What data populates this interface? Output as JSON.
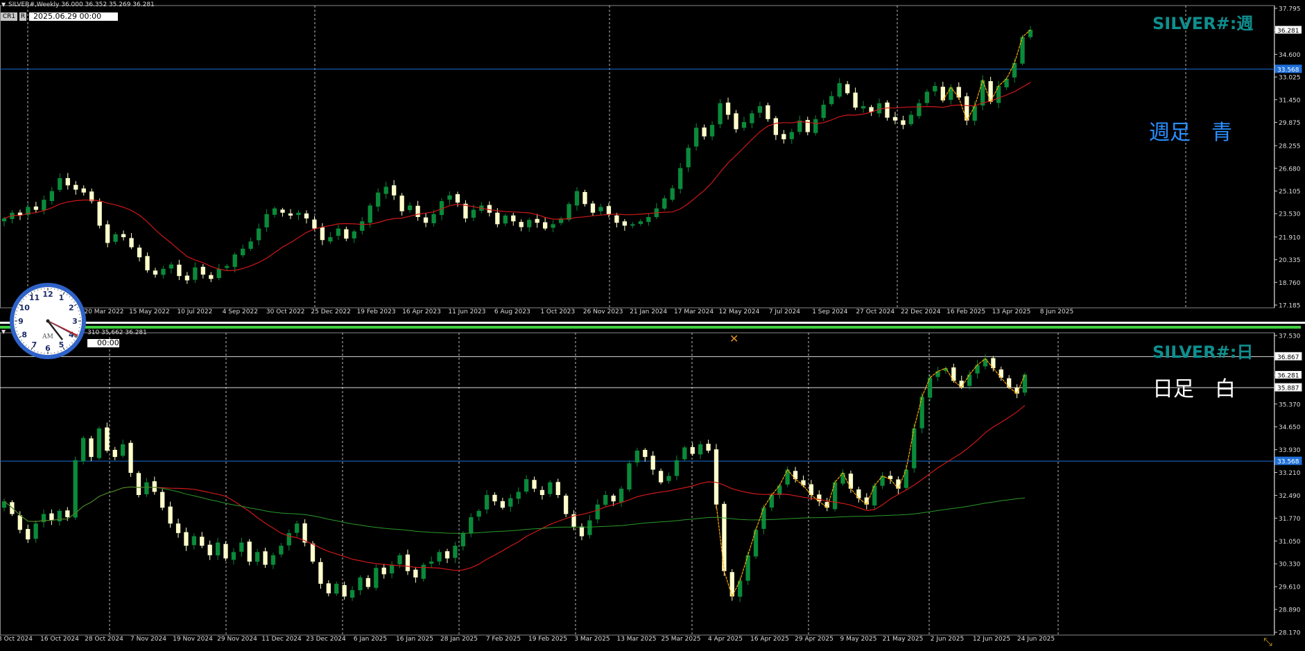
{
  "top": {
    "header": "SILVER#,Weekly  36.000 36.352 35.269 36.281",
    "btn_cr": "CR1",
    "btn_r": "R",
    "datetime": "2025.06.29 00:00",
    "symbol_label": "SILVER#:週",
    "note": "週足　青",
    "dates": [
      "20 Mar 2022",
      "15 May 2022",
      "10 Jul 2022",
      "4 Sep 2022",
      "30 Oct 2022",
      "25 Dec 2022",
      "19 Feb 2023",
      "16 Apr 2023",
      "11 Jun 2023",
      "6 Aug 2023",
      "1 Oct 2023",
      "26 Nov 2023",
      "21 Jan 2024",
      "17 Mar 2024",
      "12 May 2024",
      "7 Jul 2024",
      "1 Sep 2024",
      "27 Oct 2024",
      "22 Dec 2024",
      "16 Feb 2025",
      "13 Apr 2025",
      "8 Jun 2025"
    ],
    "prices": [
      "37.795",
      "36.281",
      "34.600",
      "33.568",
      "33.025",
      "31.450",
      "29.875",
      "28.255",
      "26.680",
      "25.105",
      "23.530",
      "21.910",
      "20.335",
      "18.760",
      "17.185"
    ],
    "hline_label": "33.568",
    "current_label": "36.281"
  },
  "bottom": {
    "header": "310 35.662 36.281",
    "datetime": "00:00",
    "symbol_label": "SILVER#:日",
    "note": "日足　白",
    "dates": [
      "3 Oct 2024",
      "16 Oct 2024",
      "28 Oct 2024",
      "7 Nov 2024",
      "19 Nov 2024",
      "29 Nov 2024",
      "11 Dec 2024",
      "23 Dec 2024",
      "6 Jan 2025",
      "16 Jan 2025",
      "28 Jan 2025",
      "7 Feb 2025",
      "19 Feb 2025",
      "3 Mar 2025",
      "13 Mar 2025",
      "25 Mar 2025",
      "4 Apr 2025",
      "16 Apr 2025",
      "29 Apr 2025",
      "9 May 2025",
      "21 May 2025",
      "2 Jun 2025",
      "12 Jun 2025",
      "24 Jun 2025"
    ],
    "prices": [
      "37.530",
      "36.867",
      "36.281",
      "35.887",
      "35.370",
      "34.650",
      "33.930",
      "33.568",
      "33.210",
      "32.490",
      "31.770",
      "31.050",
      "30.330",
      "29.610",
      "28.890",
      "28.170"
    ],
    "hline_blue_label": "33.568",
    "hline_white1_label": "36.867",
    "hline_white2_label": "35.887",
    "current_label": "36.281"
  },
  "clock": {
    "numbers": [
      "12",
      "1",
      "2",
      "3",
      "4",
      "5",
      "6",
      "7",
      "8",
      "9",
      "10",
      "11"
    ],
    "am": "AM"
  },
  "colors": {
    "bull": "#0a8a3a",
    "bear": "#ffffcc",
    "ma_red": "#d01818",
    "ma_green": "#2a9a2a",
    "zigzag": "#ffa800",
    "hline_blue": "#1e6fd8",
    "label_teal": "#0e8f8f",
    "note_blue": "#2a8fff"
  },
  "chart_data": [
    {
      "type": "candlestick",
      "title": "SILVER#:週",
      "timeframe": "Weekly",
      "ylim": [
        17.185,
        37.795
      ],
      "x_ticks": [
        "20 Mar 2022",
        "15 May 2022",
        "10 Jul 2022",
        "4 Sep 2022",
        "30 Oct 2022",
        "25 Dec 2022",
        "19 Feb 2023",
        "16 Apr 2023",
        "11 Jun 2023",
        "6 Aug 2023",
        "1 Oct 2023",
        "26 Nov 2023",
        "21 Jan 2024",
        "17 Mar 2024",
        "12 May 2024",
        "7 Jul 2024",
        "1 Sep 2024",
        "27 Oct 2024",
        "22 Dec 2024",
        "16 Feb 2025",
        "13 Apr 2025",
        "8 Jun 2025"
      ],
      "close_path": [
        23.2,
        23.6,
        23.4,
        24.0,
        23.8,
        24.5,
        25.1,
        26.0,
        25.5,
        25.2,
        25.0,
        24.4,
        22.7,
        21.5,
        22.1,
        21.9,
        21.2,
        20.5,
        19.6,
        19.3,
        19.7,
        20.0,
        19.2,
        18.9,
        19.8,
        19.3,
        19.0,
        19.7,
        19.9,
        20.7,
        21.1,
        21.6,
        22.5,
        23.5,
        23.9,
        23.6,
        23.4,
        23.6,
        23.2,
        22.5,
        21.7,
        21.9,
        22.5,
        21.8,
        22.3,
        23.0,
        24.1,
        25.0,
        25.4,
        24.8,
        23.7,
        24.1,
        23.3,
        22.9,
        23.5,
        24.4,
        24.8,
        24.3,
        23.2,
        23.8,
        24.1,
        23.6,
        22.8,
        23.4,
        23.0,
        22.6,
        23.1,
        22.9,
        22.5,
        22.8,
        23.2,
        24.2,
        25.1,
        24.2,
        23.6,
        24.0,
        23.5,
        22.9,
        22.7,
        22.8,
        23.0,
        23.3,
        23.9,
        24.6,
        25.3,
        26.7,
        28.1,
        29.5,
        28.9,
        29.7,
        31.2,
        30.4,
        29.4,
        29.9,
        30.5,
        31.0,
        30.1,
        29.0,
        28.7,
        29.2,
        30.0,
        29.2,
        30.1,
        31.1,
        31.7,
        32.6,
        31.9,
        30.9,
        31.0,
        30.6,
        31.2,
        30.2,
        30.0,
        29.7,
        30.4,
        31.2,
        32.0,
        32.4,
        31.4,
        32.3,
        31.6,
        30.0,
        31.0,
        32.8,
        31.3,
        32.4,
        32.9,
        34.0,
        35.8,
        36.3
      ]
    },
    {
      "type": "candlestick",
      "title": "SILVER#:日",
      "timeframe": "Daily",
      "ylim": [
        28.17,
        37.53
      ],
      "x_ticks": [
        "3 Oct 2024",
        "16 Oct 2024",
        "28 Oct 2024",
        "7 Nov 2024",
        "19 Nov 2024",
        "29 Nov 2024",
        "11 Dec 2024",
        "23 Dec 2024",
        "6 Jan 2025",
        "16 Jan 2025",
        "28 Jan 2025",
        "7 Feb 2025",
        "19 Feb 2025",
        "3 Mar 2025",
        "13 Mar 2025",
        "25 Mar 2025",
        "4 Apr 2025",
        "16 Apr 2025",
        "29 Apr 2025",
        "9 May 2025",
        "21 May 2025",
        "2 Jun 2025",
        "12 Jun 2025",
        "24 Jun 2025"
      ],
      "close_path": [
        32.3,
        31.9,
        31.4,
        31.1,
        31.6,
        31.9,
        31.7,
        32.0,
        31.8,
        33.6,
        34.3,
        33.7,
        34.6,
        33.9,
        33.7,
        34.1,
        33.2,
        32.5,
        32.9,
        32.6,
        32.1,
        31.6,
        31.3,
        30.9,
        31.2,
        30.9,
        30.6,
        31.0,
        30.5,
        30.7,
        31.0,
        30.4,
        30.7,
        30.3,
        30.6,
        30.9,
        31.3,
        31.6,
        31.0,
        30.4,
        29.7,
        29.4,
        29.7,
        29.3,
        29.5,
        29.9,
        29.6,
        30.2,
        30.0,
        30.3,
        30.6,
        30.1,
        29.9,
        30.3,
        30.4,
        30.7,
        30.5,
        30.9,
        31.3,
        31.8,
        32.0,
        32.5,
        32.3,
        32.1,
        32.4,
        32.6,
        33.0,
        32.7,
        32.5,
        32.9,
        32.5,
        31.9,
        31.5,
        31.2,
        31.7,
        32.2,
        32.5,
        32.3,
        32.7,
        33.5,
        33.9,
        33.7,
        33.3,
        32.9,
        33.1,
        33.6,
        34.0,
        33.8,
        34.1,
        33.9,
        32.2,
        30.1,
        29.3,
        29.8,
        30.6,
        31.4,
        32.1,
        32.5,
        32.8,
        33.3,
        33.0,
        32.8,
        32.5,
        32.3,
        32.1,
        32.9,
        33.2,
        32.7,
        32.4,
        32.2,
        32.8,
        33.1,
        33.0,
        32.7,
        33.3,
        34.6,
        35.6,
        36.2,
        36.4,
        36.5,
        36.1,
        35.9,
        36.3,
        36.6,
        36.8,
        36.5,
        36.2,
        35.9,
        35.7,
        36.3
      ]
    }
  ]
}
